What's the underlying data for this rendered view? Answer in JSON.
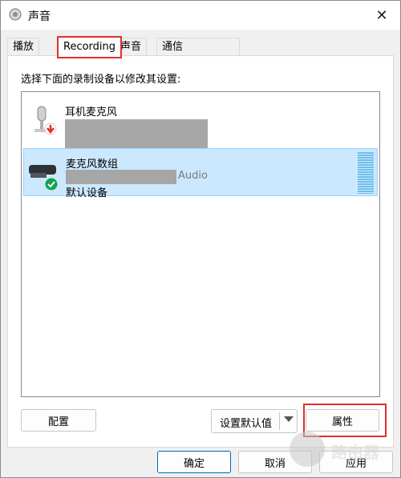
{
  "window": {
    "title": "声音",
    "close_glyph": "✕"
  },
  "tabs": [
    {
      "label": "播放"
    },
    {
      "label": "Recording"
    },
    {
      "label": "声音"
    },
    {
      "label": "通信"
    }
  ],
  "instruction": "选择下面的录制设备以修改其设置:",
  "devices": [
    {
      "name": "耳机麦克风",
      "icon": "headset-mic-icon",
      "status_icon": "disconnected-arrow-icon"
    },
    {
      "name": "麦克风数组",
      "subtitle_suffix": "Audio",
      "status": "默认设备",
      "icon": "mic-array-icon",
      "status_icon": "default-check-icon"
    }
  ],
  "buttons": {
    "configure": "配置",
    "set_default": "设置默认值",
    "properties": "属性",
    "ok": "确定",
    "cancel": "取消",
    "apply": "应用"
  },
  "watermark": "路由器",
  "colors": {
    "selection": "#cce8ff",
    "highlight": "#e03030",
    "accent": "#0067c0"
  }
}
